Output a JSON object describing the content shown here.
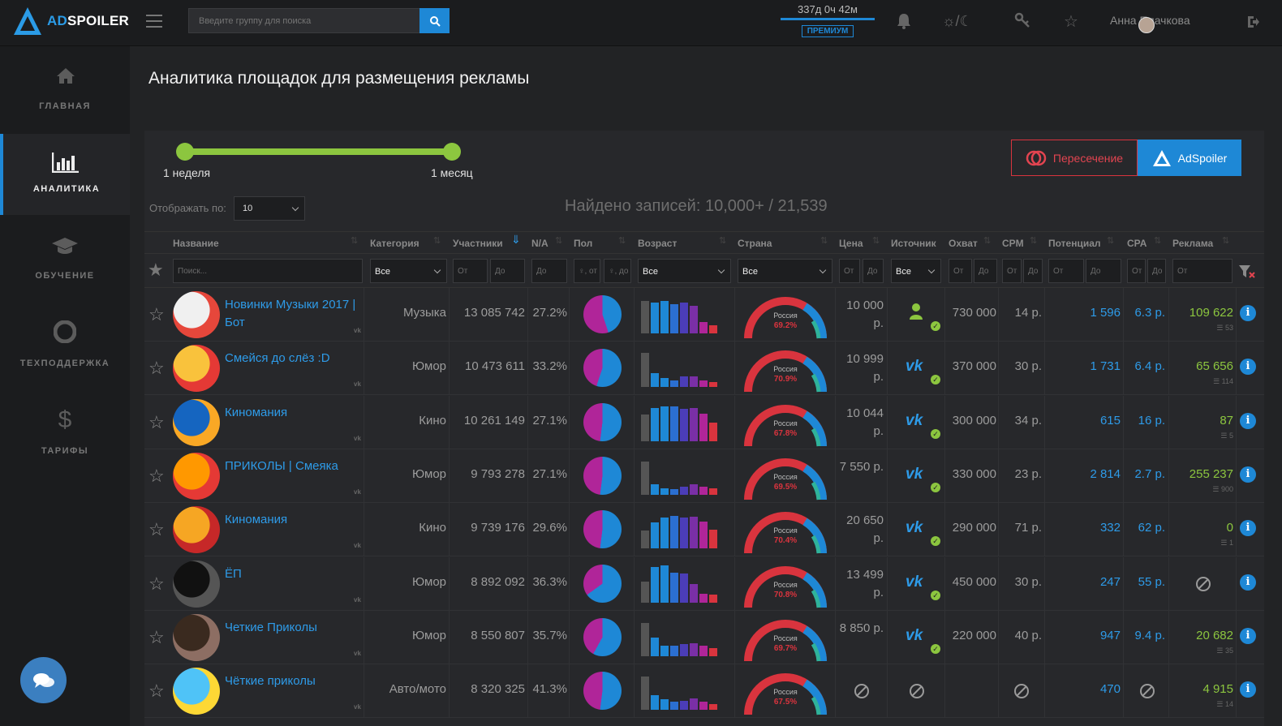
{
  "app": {
    "brand_a": "AD",
    "brand_b": "SPOILER"
  },
  "search": {
    "placeholder": "Введите группу для поиска"
  },
  "timer": {
    "text": "337д 0ч 42м",
    "premium": "ПРЕМИУМ"
  },
  "user": {
    "name": "Анна Плачкова"
  },
  "nav": [
    {
      "label": "ГЛАВНАЯ",
      "icon": "home-icon"
    },
    {
      "label": "АНАЛИТИКА",
      "icon": "bar-chart-icon"
    },
    {
      "label": "ОБУЧЕНИЕ",
      "icon": "graduation-cap-icon"
    },
    {
      "label": "ТЕХПОДДЕРЖКА",
      "icon": "lifebuoy-icon"
    },
    {
      "label": "ТАРИФЫ",
      "icon": "dollar-icon"
    }
  ],
  "page": {
    "title": "Аналитика площадок для размещения рекламы"
  },
  "period": {
    "from": "1 неделя",
    "to": "1 месяц"
  },
  "buttons": {
    "intersection": "Пересечение",
    "adspoiler": "AdSpoiler"
  },
  "show_by": {
    "label": "Отображать по:",
    "value": "10"
  },
  "found": "Найдено записей: 10,000+ / 21,539",
  "columns": {
    "name": "Название",
    "category": "Категория",
    "members": "Участники",
    "na": "N/A",
    "gender": "Пол",
    "age": "Возраст",
    "country": "Страна",
    "price": "Цена",
    "source": "Источник",
    "reach": "Охват",
    "cpm": "CPM",
    "potential": "Потенциал",
    "cpa": "CPA",
    "ads": "Реклама"
  },
  "filters": {
    "search": "Поиск...",
    "category": "Все",
    "from": "От",
    "to": "До",
    "gender_from": "♀, от",
    "gender_to": "♀, до",
    "age": "Все",
    "country": "Все",
    "source": "Все"
  },
  "colors": {
    "accent": "#1e88d6",
    "green": "#8cc63f",
    "red": "#d9343e",
    "pink": "#b02599"
  },
  "rows": [
    {
      "name": "Новинки Музыки 2017 | Бот",
      "category": "Музыка",
      "members": "13 085 742",
      "na": "27.2%",
      "female": 0.55,
      "age": [
        0.88,
        0.82,
        0.86,
        0.78,
        0.82,
        0.75,
        0.3,
        0.22
      ],
      "country": "Россия",
      "country_pct": "69.2%",
      "price": "10 000 р.",
      "source": "user-icon",
      "reach": "730 000",
      "cpm": "14 р.",
      "potential": "1 596",
      "cpa": "6.3 р.",
      "ads": "109 622",
      "ads_sub": "53"
    },
    {
      "name": "Смейся до слёз :D",
      "category": "Юмор",
      "members": "10 473 611",
      "na": "33.2%",
      "female": 0.45,
      "age": [
        0.92,
        0.38,
        0.25,
        0.18,
        0.28,
        0.3,
        0.18,
        0.14
      ],
      "country": "Россия",
      "country_pct": "70.9%",
      "price": "10 999 р.",
      "source": "vk-icon",
      "reach": "370 000",
      "cpm": "30 р.",
      "potential": "1 731",
      "cpa": "6.4 р.",
      "ads": "65 656",
      "ads_sub": "114"
    },
    {
      "name": "Киномания",
      "category": "Кино",
      "members": "10 261 149",
      "na": "27.1%",
      "female": 0.48,
      "age": [
        0.7,
        0.88,
        0.92,
        0.92,
        0.86,
        0.88,
        0.72,
        0.5
      ],
      "country": "Россия",
      "country_pct": "67.8%",
      "price": "10 044 р.",
      "source": "vk-icon",
      "reach": "300 000",
      "cpm": "34 р.",
      "potential": "615",
      "cpa": "16 р.",
      "ads": "87",
      "ads_sub": "5"
    },
    {
      "name": "ПРИКОЛЫ | Смеяка",
      "category": "Юмор",
      "members": "9 793 278",
      "na": "27.1%",
      "female": 0.48,
      "age": [
        0.9,
        0.28,
        0.18,
        0.14,
        0.22,
        0.28,
        0.22,
        0.18
      ],
      "country": "Россия",
      "country_pct": "69.5%",
      "price": "7 550 р.",
      "source": "vk-icon",
      "reach": "330 000",
      "cpm": "23 р.",
      "potential": "2 814",
      "cpa": "2.7 р.",
      "ads": "255 237",
      "ads_sub": "900"
    },
    {
      "name": "Киномания",
      "category": "Кино",
      "members": "9 739 176",
      "na": "29.6%",
      "female": 0.48,
      "age": [
        0.48,
        0.7,
        0.82,
        0.88,
        0.82,
        0.86,
        0.72,
        0.5
      ],
      "country": "Россия",
      "country_pct": "70.4%",
      "price": "20 650 р.",
      "source": "vk-icon",
      "reach": "290 000",
      "cpm": "71 р.",
      "potential": "332",
      "cpa": "62 р.",
      "ads": "0",
      "ads_sub": "1"
    },
    {
      "name": "ЁП",
      "category": "Юмор",
      "members": "8 892 092",
      "na": "36.3%",
      "female": 0.35,
      "age": [
        0.55,
        0.95,
        0.98,
        0.8,
        0.78,
        0.5,
        0.22,
        0.2
      ],
      "country": "Россия",
      "country_pct": "70.8%",
      "price": "13 499 р.",
      "source": "vk-icon",
      "reach": "450 000",
      "cpm": "30 р.",
      "potential": "247",
      "cpa": "55 р.",
      "ads": "",
      "ads_sub": ""
    },
    {
      "name": "Четкие Приколы",
      "category": "Юмор",
      "members": "8 550 807",
      "na": "35.7%",
      "female": 0.42,
      "age": [
        0.88,
        0.5,
        0.28,
        0.28,
        0.32,
        0.34,
        0.28,
        0.22
      ],
      "country": "Россия",
      "country_pct": "69.7%",
      "price": "8 850 р.",
      "source": "vk-icon",
      "reach": "220 000",
      "cpm": "40 р.",
      "potential": "947",
      "cpa": "9.4 р.",
      "ads": "20 682",
      "ads_sub": "35"
    },
    {
      "name": "Чёткие приколы",
      "category": "Авто/мото",
      "members": "8 320 325",
      "na": "41.3%",
      "female": 0.48,
      "age": [
        0.9,
        0.4,
        0.28,
        0.22,
        0.25,
        0.3,
        0.22,
        0.16
      ],
      "country": "Россия",
      "country_pct": "67.5%",
      "price": "",
      "source": "",
      "reach": "",
      "cpm": "",
      "potential": "470",
      "cpa": "",
      "ads": "4 915",
      "ads_sub": "14"
    }
  ]
}
